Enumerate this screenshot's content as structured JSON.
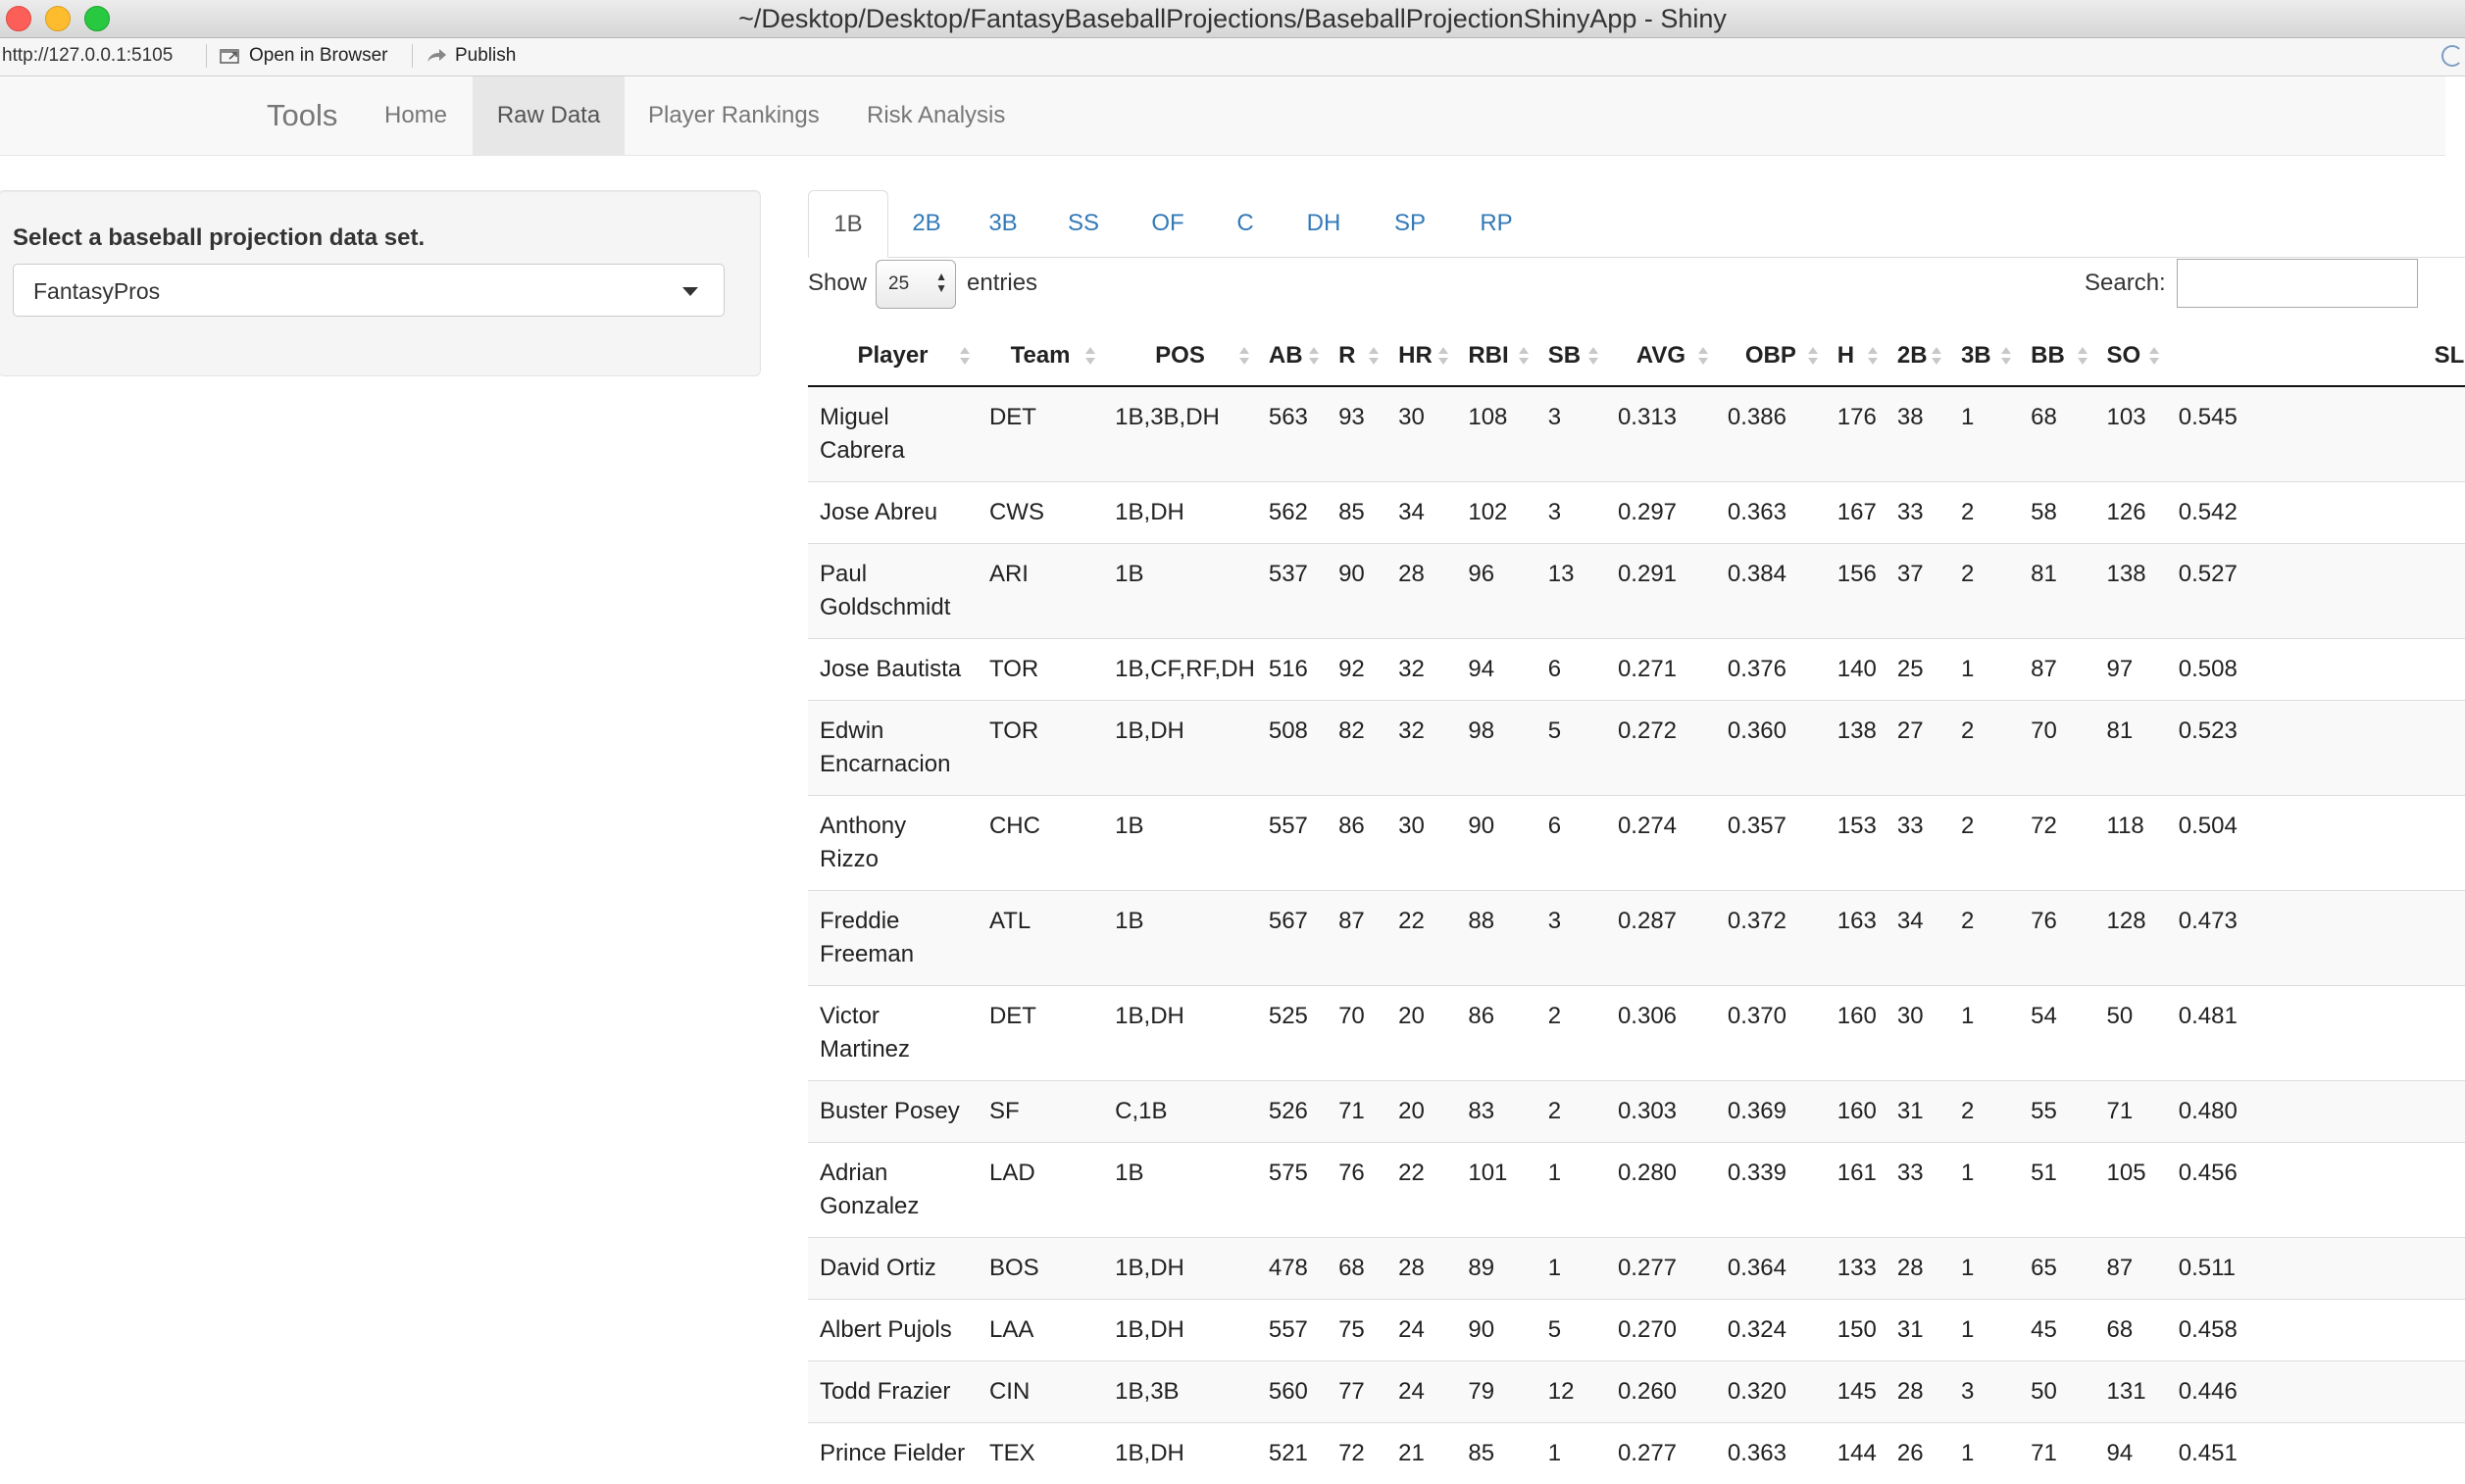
{
  "window": {
    "title": "~/Desktop/Desktop/FantasyBaseballProjections/BaseballProjectionShinyApp - Shiny"
  },
  "viewer": {
    "url": "http://127.0.0.1:5105",
    "open_in_browser": "Open in Browser",
    "publish": "Publish"
  },
  "navbar": {
    "brand": "Tools",
    "tabs": [
      {
        "label": "Home"
      },
      {
        "label": "Raw Data",
        "active": true
      },
      {
        "label": "Player Rankings"
      },
      {
        "label": "Risk Analysis"
      }
    ]
  },
  "sidebar": {
    "label": "Select a baseball projection data set.",
    "selected": "FantasyPros"
  },
  "position_tabs": [
    {
      "label": "1B",
      "active": true
    },
    {
      "label": "2B"
    },
    {
      "label": "3B"
    },
    {
      "label": "SS"
    },
    {
      "label": "OF"
    },
    {
      "label": "C"
    },
    {
      "label": "DH"
    },
    {
      "label": "SP"
    },
    {
      "label": "RP"
    }
  ],
  "controls": {
    "show_label": "Show",
    "length_value": "25",
    "entries_label": "entries",
    "search_label": "Search:",
    "search_value": ""
  },
  "table": {
    "headers": [
      "Player",
      "Team",
      "POS",
      "AB",
      "R",
      "HR",
      "RBI",
      "SB",
      "AVG",
      "OBP",
      "H",
      "2B",
      "3B",
      "BB",
      "SO",
      "SLG"
    ],
    "rows": [
      [
        "Miguel Cabrera",
        "DET",
        "1B,3B,DH",
        "563",
        "93",
        "30",
        "108",
        "3",
        "0.313",
        "0.386",
        "176",
        "38",
        "1",
        "68",
        "103",
        "0.545"
      ],
      [
        "Jose Abreu",
        "CWS",
        "1B,DH",
        "562",
        "85",
        "34",
        "102",
        "3",
        "0.297",
        "0.363",
        "167",
        "33",
        "2",
        "58",
        "126",
        "0.542"
      ],
      [
        "Paul Goldschmidt",
        "ARI",
        "1B",
        "537",
        "90",
        "28",
        "96",
        "13",
        "0.291",
        "0.384",
        "156",
        "37",
        "2",
        "81",
        "138",
        "0.527"
      ],
      [
        "Jose Bautista",
        "TOR",
        "1B,CF,RF,DH",
        "516",
        "92",
        "32",
        "94",
        "6",
        "0.271",
        "0.376",
        "140",
        "25",
        "1",
        "87",
        "97",
        "0.508"
      ],
      [
        "Edwin Encarnacion",
        "TOR",
        "1B,DH",
        "508",
        "82",
        "32",
        "98",
        "5",
        "0.272",
        "0.360",
        "138",
        "27",
        "2",
        "70",
        "81",
        "0.523"
      ],
      [
        "Anthony Rizzo",
        "CHC",
        "1B",
        "557",
        "86",
        "30",
        "90",
        "6",
        "0.274",
        "0.357",
        "153",
        "33",
        "2",
        "72",
        "118",
        "0.504"
      ],
      [
        "Freddie Freeman",
        "ATL",
        "1B",
        "567",
        "87",
        "22",
        "88",
        "3",
        "0.287",
        "0.372",
        "163",
        "34",
        "2",
        "76",
        "128",
        "0.473"
      ],
      [
        "Victor Martinez",
        "DET",
        "1B,DH",
        "525",
        "70",
        "20",
        "86",
        "2",
        "0.306",
        "0.370",
        "160",
        "30",
        "1",
        "54",
        "50",
        "0.481"
      ],
      [
        "Buster Posey",
        "SF",
        "C,1B",
        "526",
        "71",
        "20",
        "83",
        "2",
        "0.303",
        "0.369",
        "160",
        "31",
        "2",
        "55",
        "71",
        "0.480"
      ],
      [
        "Adrian Gonzalez",
        "LAD",
        "1B",
        "575",
        "76",
        "22",
        "101",
        "1",
        "0.280",
        "0.339",
        "161",
        "33",
        "1",
        "51",
        "105",
        "0.456"
      ],
      [
        "David Ortiz",
        "BOS",
        "1B,DH",
        "478",
        "68",
        "28",
        "89",
        "1",
        "0.277",
        "0.364",
        "133",
        "28",
        "1",
        "65",
        "87",
        "0.511"
      ],
      [
        "Albert Pujols",
        "LAA",
        "1B,DH",
        "557",
        "75",
        "24",
        "90",
        "5",
        "0.270",
        "0.324",
        "150",
        "31",
        "1",
        "45",
        "68",
        "0.458"
      ],
      [
        "Todd Frazier",
        "CIN",
        "1B,3B",
        "560",
        "77",
        "24",
        "79",
        "12",
        "0.260",
        "0.320",
        "145",
        "28",
        "3",
        "50",
        "131",
        "0.446"
      ],
      [
        "Prince Fielder",
        "TEX",
        "1B,DH",
        "521",
        "72",
        "21",
        "85",
        "1",
        "0.277",
        "0.363",
        "144",
        "26",
        "1",
        "71",
        "94",
        "0.451"
      ]
    ]
  }
}
